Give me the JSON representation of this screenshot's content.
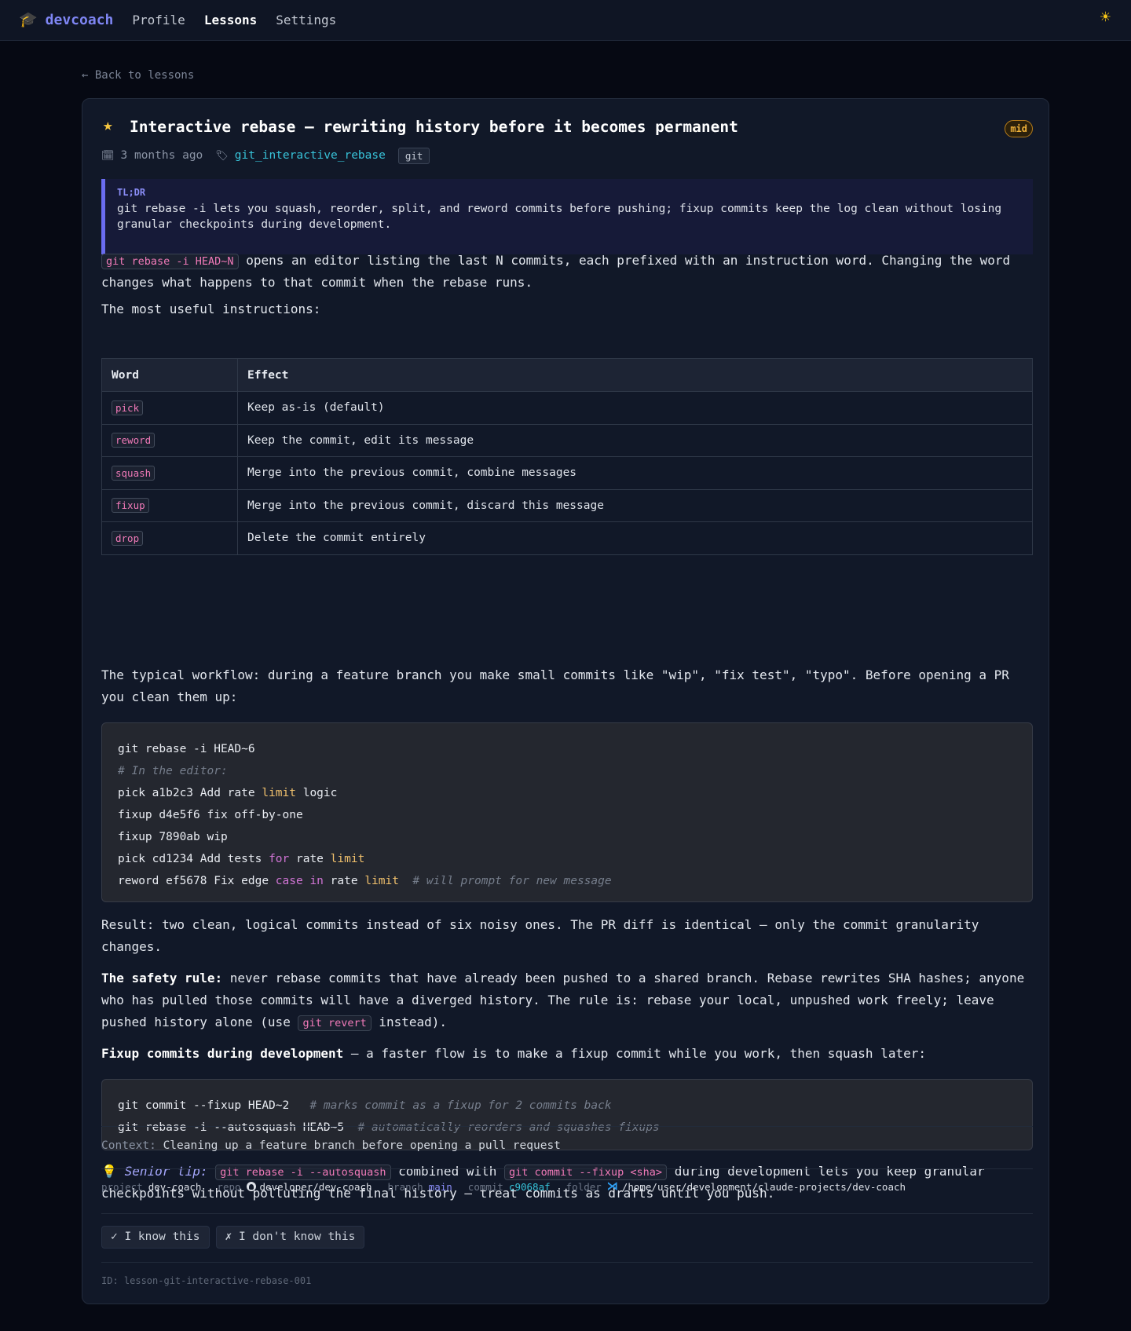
{
  "nav": {
    "brand_icon": "graduation-cap-icon",
    "brand_icon_glyph": "🎓",
    "brand": "devcoach",
    "links": [
      "Profile",
      "Lessons",
      "Settings"
    ],
    "active": "Lessons",
    "theme_icon": "sun-icon",
    "theme_glyph": "☀"
  },
  "back_link": "← Back to lessons",
  "lesson": {
    "star_glyph": "★",
    "title": "Interactive rebase — rewriting history before it becomes permanent",
    "level": "mid",
    "date_icon": "🗓",
    "date": "3 months ago",
    "tag_icon": "🏷",
    "tag_link": "git_interactive_rebase",
    "category": "git",
    "tldr_label": "TL;DR",
    "tldr": "git rebase -i lets you squash, reorder, split, and reword commits before pushing; fixup commits keep the log clean without losing granular checkpoints during development.",
    "intro_code": "git rebase -i HEAD~N",
    "intro_text": " opens an editor listing the last N commits, each prefixed with an instruction word. Changing the word changes what happens to that commit when the rebase runs.",
    "instructions_heading": "The most useful instructions:",
    "table": {
      "headers": [
        "Word",
        "Effect"
      ],
      "rows": [
        {
          "word": "pick",
          "effect": "Keep as-is (default)"
        },
        {
          "word": "reword",
          "effect": "Keep the commit, edit its message"
        },
        {
          "word": "squash",
          "effect": "Merge into the previous commit, combine messages"
        },
        {
          "word": "fixup",
          "effect": "Merge into the previous commit, discard this message"
        },
        {
          "word": "drop",
          "effect": "Delete the commit entirely"
        }
      ]
    },
    "workflow_text": "The typical workflow: during a feature branch you make small commits like \"wip\", \"fix test\", \"typo\". Before opening a PR you clean them up:",
    "code1": {
      "line1": "git rebase -i HEAD~6",
      "line2": "# In the editor:",
      "line3": [
        "pick a1b2c3 Add rate ",
        "limit",
        " logic"
      ],
      "line4": "fixup d4e5f6 fix off-by-one",
      "line5": "fixup 7890ab wip",
      "line6": [
        "pick cd1234 Add tests ",
        "for",
        " rate ",
        "limit"
      ],
      "line7": [
        "reword ef5678 Fix edge ",
        "case",
        " ",
        "in",
        " rate ",
        "limit",
        "  # will prompt for new message"
      ]
    },
    "result_text": "Result: two clean, logical commits instead of six noisy ones. The PR diff is identical — only the commit granularity changes.",
    "safety_bold": "The safety rule:",
    "safety_text": " never rebase commits that have already been pushed to a shared branch. Rebase rewrites SHA hashes; anyone who has pulled those commits will have a diverged history. The rule is: rebase your local, unpushed work freely; leave pushed history alone (use ",
    "safety_code": "git revert",
    "safety_end": " instead).",
    "fixup_bold": "Fixup commits during development",
    "fixup_text": " — a faster flow is to make a fixup commit while you work, then squash later:",
    "code2": {
      "line1_cmd": "git commit --fixup HEAD~2",
      "line1_comment": "   # marks commit as a fixup for 2 commits back",
      "line2_cmd": "git rebase -i --autosquash HEAD~5",
      "line2_comment": "  # automatically reorders and squashes fixups"
    },
    "tip_icon": "💡",
    "tip_label": "Senior tip:",
    "tip_code1": "git rebase -i --autosquash",
    "tip_mid": " combined with ",
    "tip_code2": "git commit --fixup <sha>",
    "tip_end": " during development lets you keep granular checkpoints without polluting the final history — treat commits as drafts until you push.",
    "context_label": "Context:",
    "context": "Cleaning up a feature branch before opening a pull request",
    "info": {
      "project_label": "project",
      "project": "dev-coach",
      "repo_label": "repo",
      "repo": "developer/dev-coach",
      "branch_label": "branch",
      "branch": "main",
      "commit_label": "commit",
      "commit": "c9068af",
      "folder_label": "folder",
      "folder": "/home/user/development/claude-projects/dev-coach"
    },
    "know_button": "✓ I know this",
    "dont_know_button": "✗ I don't know this",
    "id_text": "ID: lesson-git-interactive-rebase-001"
  },
  "colors": {
    "background": "#060913",
    "brand": "#7f86f4",
    "accent_code": "#f07ab8",
    "level_badge": "#f0b23a",
    "link": "#38c3d9"
  }
}
